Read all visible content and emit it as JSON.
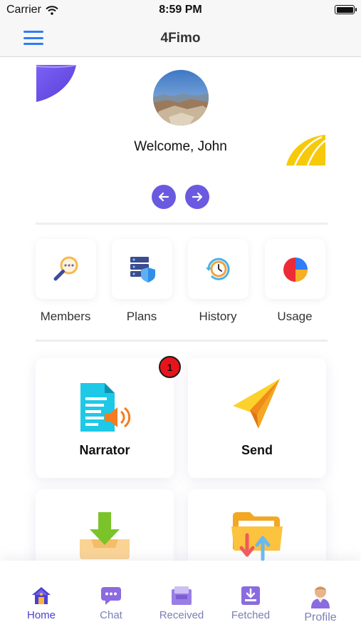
{
  "status_bar": {
    "carrier": "Carrier",
    "time": "8:59 PM"
  },
  "nav": {
    "title": "4Fimo",
    "menu_icon": "hamburger-menu-icon"
  },
  "hero": {
    "welcome_text": "Welcome, John",
    "prev_icon": "arrow-left-icon",
    "next_icon": "arrow-right-icon"
  },
  "quick_actions": [
    {
      "label": "Members",
      "icon": "magnifier-icon"
    },
    {
      "label": "Plans",
      "icon": "server-shield-icon"
    },
    {
      "label": "History",
      "icon": "clock-history-icon"
    },
    {
      "label": "Usage",
      "icon": "pie-chart-icon"
    }
  ],
  "features": [
    {
      "label": "Narrator",
      "icon": "document-speaker-icon",
      "badge": "1"
    },
    {
      "label": "Send",
      "icon": "paper-plane-icon"
    },
    {
      "label": "",
      "icon": "download-tray-icon"
    },
    {
      "label": "",
      "icon": "folder-transfer-icon"
    }
  ],
  "tabs": [
    {
      "label": "Home",
      "icon": "home-icon",
      "active": true
    },
    {
      "label": "Chat",
      "icon": "chat-icon",
      "active": false
    },
    {
      "label": "Received",
      "icon": "received-icon",
      "active": false
    },
    {
      "label": "Fetched",
      "icon": "fetched-icon",
      "active": false
    },
    {
      "label": "Profile",
      "icon": "profile-icon",
      "active": false
    }
  ],
  "colors": {
    "accent": "#6a5ae0",
    "menu": "#2f7cf6",
    "active_tab": "#4b3fcf",
    "inactive_tab": "#7b7fb5",
    "badge": "#e8141c"
  }
}
